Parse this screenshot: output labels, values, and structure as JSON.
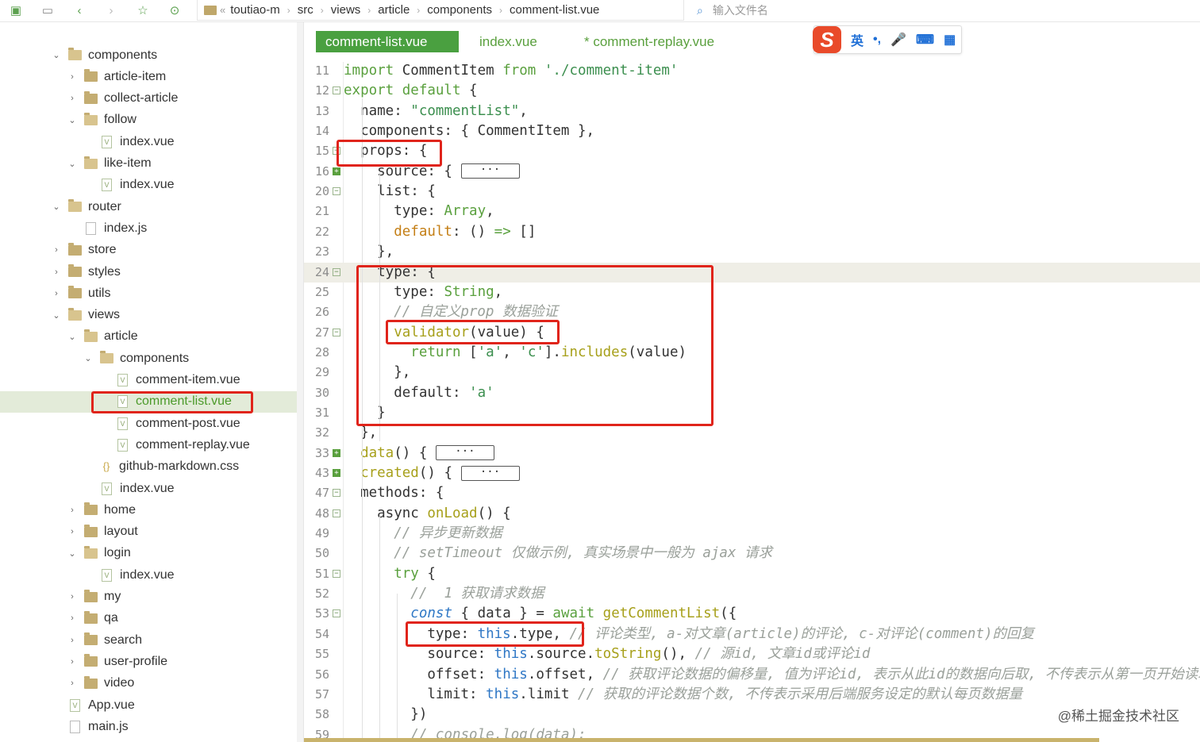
{
  "toolbar": {
    "breadcrumbs": [
      "toutiao-m",
      "src",
      "views",
      "article",
      "components",
      "comment-list.vue"
    ],
    "file_search_placeholder": "输入文件名",
    "back_marker": "«"
  },
  "sidebar": {
    "items": [
      {
        "label": "components",
        "kind": "folder",
        "expanded": true,
        "depth": 0
      },
      {
        "label": "article-item",
        "kind": "folder",
        "expanded": false,
        "depth": 1
      },
      {
        "label": "collect-article",
        "kind": "folder",
        "expanded": false,
        "depth": 1
      },
      {
        "label": "follow",
        "kind": "folder",
        "expanded": true,
        "depth": 1
      },
      {
        "label": "index.vue",
        "kind": "vue",
        "depth": 2
      },
      {
        "label": "like-item",
        "kind": "folder",
        "expanded": true,
        "depth": 1
      },
      {
        "label": "index.vue",
        "kind": "vue",
        "depth": 2
      },
      {
        "label": "router",
        "kind": "folder",
        "expanded": true,
        "depth": 0
      },
      {
        "label": "index.js",
        "kind": "js",
        "depth": 1
      },
      {
        "label": "store",
        "kind": "folder",
        "expanded": false,
        "depth": 0
      },
      {
        "label": "styles",
        "kind": "folder",
        "expanded": false,
        "depth": 0
      },
      {
        "label": "utils",
        "kind": "folder",
        "expanded": false,
        "depth": 0
      },
      {
        "label": "views",
        "kind": "folder",
        "expanded": true,
        "depth": 0
      },
      {
        "label": "article",
        "kind": "folder",
        "expanded": true,
        "depth": 1
      },
      {
        "label": "components",
        "kind": "folder",
        "expanded": true,
        "depth": 2
      },
      {
        "label": "comment-item.vue",
        "kind": "vue",
        "depth": 3
      },
      {
        "label": "comment-list.vue",
        "kind": "vue",
        "depth": 3,
        "selected": true
      },
      {
        "label": "comment-post.vue",
        "kind": "vue",
        "depth": 3
      },
      {
        "label": "comment-replay.vue",
        "kind": "vue",
        "depth": 3
      },
      {
        "label": "github-markdown.css",
        "kind": "css",
        "depth": 2
      },
      {
        "label": "index.vue",
        "kind": "vue",
        "depth": 2
      },
      {
        "label": "home",
        "kind": "folder",
        "expanded": false,
        "depth": 1
      },
      {
        "label": "layout",
        "kind": "folder",
        "expanded": false,
        "depth": 1
      },
      {
        "label": "login",
        "kind": "folder",
        "expanded": true,
        "depth": 1
      },
      {
        "label": "index.vue",
        "kind": "vue",
        "depth": 2
      },
      {
        "label": "my",
        "kind": "folder",
        "expanded": false,
        "depth": 1
      },
      {
        "label": "qa",
        "kind": "folder",
        "expanded": false,
        "depth": 1
      },
      {
        "label": "search",
        "kind": "folder",
        "expanded": false,
        "depth": 1
      },
      {
        "label": "user-profile",
        "kind": "folder",
        "expanded": false,
        "depth": 1
      },
      {
        "label": "video",
        "kind": "folder",
        "expanded": false,
        "depth": 1
      },
      {
        "label": "App.vue",
        "kind": "vue",
        "depth": 0
      },
      {
        "label": "main.js",
        "kind": "js",
        "depth": 0
      }
    ]
  },
  "tabs": [
    {
      "label": "comment-list.vue",
      "active": true
    },
    {
      "label": "index.vue",
      "active": false
    },
    {
      "label": "* comment-replay.vue",
      "active": false
    }
  ],
  "ime": {
    "logo": "S",
    "lang": "英",
    "punct": "•,",
    "mic": "🎤",
    "kbd": "⌨",
    "grid": "▦"
  },
  "code": [
    {
      "n": "11",
      "fold": "",
      "html": "<span class='kw'>import</span> CommentItem <span class='kw'>from</span> <span class='str'>'./comment-item'</span>"
    },
    {
      "n": "12",
      "fold": "minus",
      "html": "<span class='kw'>export default</span> {"
    },
    {
      "n": "13",
      "fold": "",
      "html": "  name: <span class='str'>\"commentList\"</span>,"
    },
    {
      "n": "14",
      "fold": "",
      "html": "  components: { CommentItem },"
    },
    {
      "n": "15",
      "fold": "minus",
      "html": "  props: {"
    },
    {
      "n": "16",
      "fold": "plus",
      "html": "    source: { <span class='fold-box' style='width:74px'>···</span>"
    },
    {
      "n": "20",
      "fold": "minus",
      "html": "    list: {"
    },
    {
      "n": "21",
      "fold": "",
      "html": "      type: <span class='typ'>Array</span>,"
    },
    {
      "n": "22",
      "fold": "",
      "html": "      <span class='orange'>default</span>: () <span class='kw'>=&gt;</span> []"
    },
    {
      "n": "23",
      "fold": "",
      "html": "    },"
    },
    {
      "n": "24",
      "fold": "minus",
      "hl": true,
      "html": "    type: {"
    },
    {
      "n": "25",
      "fold": "",
      "html": "      type: <span class='typ'>String</span>,"
    },
    {
      "n": "26",
      "fold": "",
      "html": "      <span class='cm'>// 自定义prop 数据验证</span>"
    },
    {
      "n": "27",
      "fold": "minus",
      "html": "      <span class='fn'>validator</span>(value) {"
    },
    {
      "n": "28",
      "fold": "",
      "html": "        <span class='kw'>return</span> [<span class='str'>'a'</span>, <span class='str'>'c'</span>].<span class='fn'>includes</span>(value)"
    },
    {
      "n": "29",
      "fold": "",
      "html": "      },"
    },
    {
      "n": "30",
      "fold": "",
      "html": "      default: <span class='str'>'a'</span>"
    },
    {
      "n": "31",
      "fold": "",
      "html": "    }"
    },
    {
      "n": "32",
      "fold": "",
      "html": "  },"
    },
    {
      "n": "33",
      "fold": "plus",
      "html": "  <span class='fn'>data</span>() { <span class='fold-box' style='width:74px'>···</span>"
    },
    {
      "n": "43",
      "fold": "plus",
      "html": "  <span class='fn'>created</span>() { <span class='fold-box' style='width:74px'>···</span>"
    },
    {
      "n": "47",
      "fold": "minus",
      "html": "  methods: {"
    },
    {
      "n": "48",
      "fold": "minus",
      "html": "    async <span class='fn'>onLoad</span>() {"
    },
    {
      "n": "49",
      "fold": "",
      "html": "      <span class='cm'>// 异步更新数据</span>"
    },
    {
      "n": "50",
      "fold": "",
      "html": "      <span class='cm'>// setTimeout 仅做示例, 真实场景中一般为 ajax 请求</span>"
    },
    {
      "n": "51",
      "fold": "minus",
      "html": "      <span class='kw'>try</span> {"
    },
    {
      "n": "52",
      "fold": "",
      "html": "        <span class='cm'>//  1 获取请求数据</span>"
    },
    {
      "n": "53",
      "fold": "minus",
      "html": "        <span class='this' style='font-style:italic'>const</span> { data } = <span class='kw'>await</span> <span class='fn'>getCommentList</span>({"
    },
    {
      "n": "54",
      "fold": "",
      "html": "          type: <span class='this'>this</span>.type, <span class='cm'>// 评论类型, a-对文章(article)的评论, c-对评论(comment)的回复</span>"
    },
    {
      "n": "55",
      "fold": "",
      "html": "          source: <span class='this'>this</span>.source.<span class='fn'>toString</span>(), <span class='cm'>// 源id, 文章id或评论id</span>"
    },
    {
      "n": "56",
      "fold": "",
      "html": "          offset: <span class='this'>this</span>.offset, <span class='cm'>// 获取评论数据的偏移量, 值为评论id, 表示从此id的数据向后取, 不传表示从第一页开始读取数据</span>"
    },
    {
      "n": "57",
      "fold": "",
      "html": "          limit: <span class='this'>this</span>.limit <span class='cm'>// 获取的评论数据个数, 不传表示采用后端服务设定的默认每页数据量</span>"
    },
    {
      "n": "58",
      "fold": "",
      "html": "        })"
    },
    {
      "n": "59",
      "fold": "",
      "html": "        <span class='cm'>// console.log(data);</span>"
    }
  ],
  "watermark": "@稀土掘金技术社区"
}
